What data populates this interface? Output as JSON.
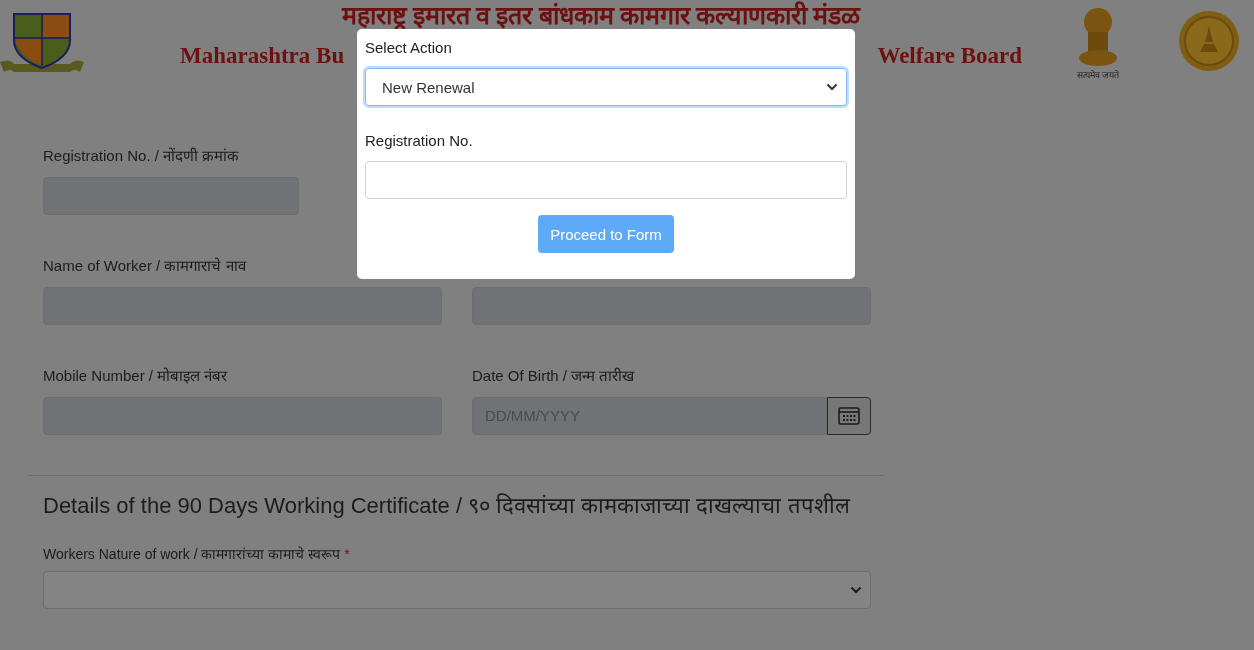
{
  "header": {
    "title_marathi": "महाराष्ट्र इमारत व इतर बांधकाम कामगार कल्याणकारी मंडळ",
    "title_english_left": "Maharashtra Bu",
    "title_english_right": "Welfare Board",
    "emblem_motto": "सत्यमेव जयते"
  },
  "form": {
    "rows": [
      {
        "fields": [
          {
            "label": "Registration No. / नोंदणी क्रमांक",
            "kind": "text",
            "disabled": true
          }
        ]
      },
      {
        "fields": [
          {
            "label": "Name of Worker / कामगाराचे नाव",
            "kind": "text",
            "disabled": true
          },
          {
            "kind": "text",
            "disabled": true
          }
        ]
      },
      {
        "fields": [
          {
            "label": "Mobile Number / मोबाइल नंबर",
            "kind": "text",
            "disabled": true
          },
          {
            "label": "Date Of Birth / जन्म तारीख",
            "kind": "date",
            "placeholder": "DD/MM/YYYY",
            "disabled": true
          }
        ]
      }
    ],
    "section_title": "Details of the 90 Days Working Certificate / ९० दिवसांच्या कामकाजाच्या दाखल्याचा तपशील",
    "nature_field": {
      "label": "Workers Nature of work / कामगारांच्या कामाचे स्वरूप",
      "required_mark": "*",
      "kind": "select",
      "disabled": false
    }
  },
  "modal": {
    "select_label": "Select Action",
    "select_value": "New Renewal",
    "reg_label": "Registration No.",
    "button": "Proceed to Form"
  }
}
